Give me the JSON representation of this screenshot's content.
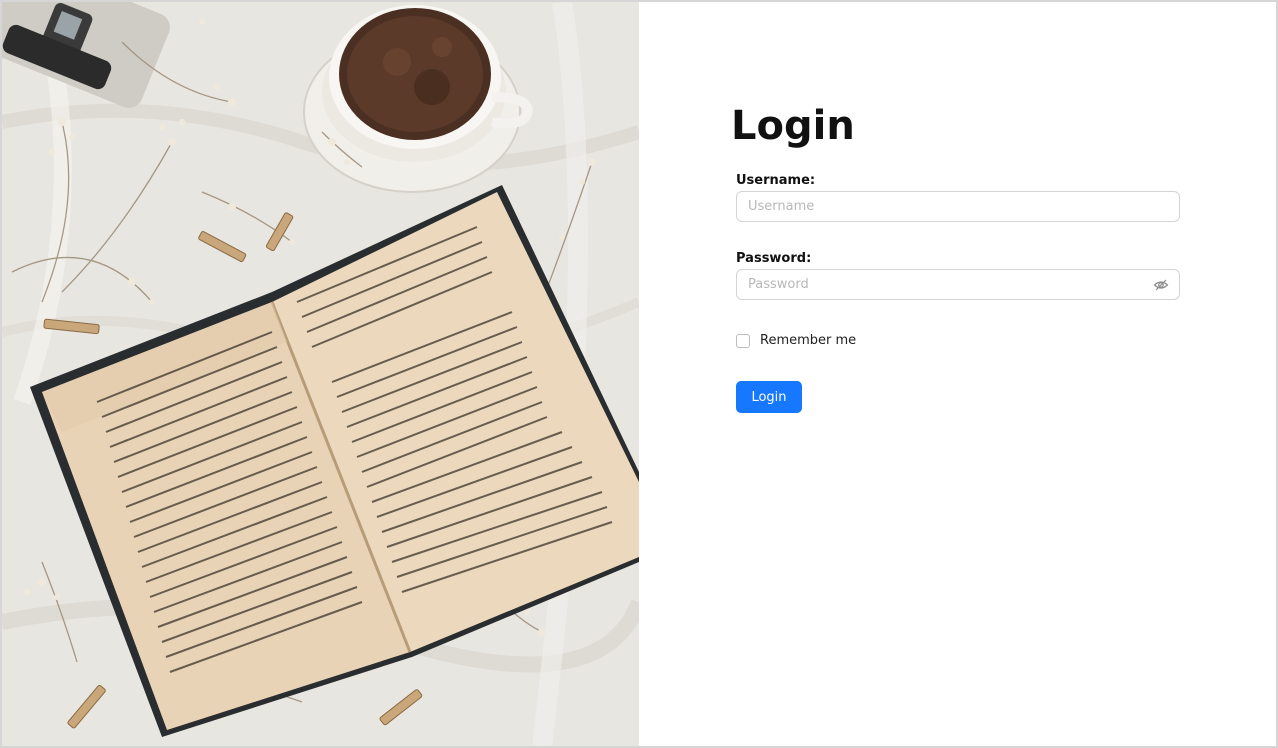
{
  "login": {
    "title": "Login",
    "username": {
      "label": "Username:",
      "placeholder": "Username",
      "value": ""
    },
    "password": {
      "label": "Password:",
      "placeholder": "Password",
      "value": "",
      "toggle_icon": "eye-slash-icon"
    },
    "remember": {
      "label": "Remember me",
      "checked": false
    },
    "submit_label": "Login"
  },
  "photo": {
    "description_icon": "hero-photo",
    "subject": "open book, coffee cup, camera, clothespins and dried flowers on white linen"
  },
  "colors": {
    "primary": "#1677ff",
    "input_border": "#d4d4d4",
    "placeholder": "#b8b8b8",
    "title": "#111111"
  }
}
